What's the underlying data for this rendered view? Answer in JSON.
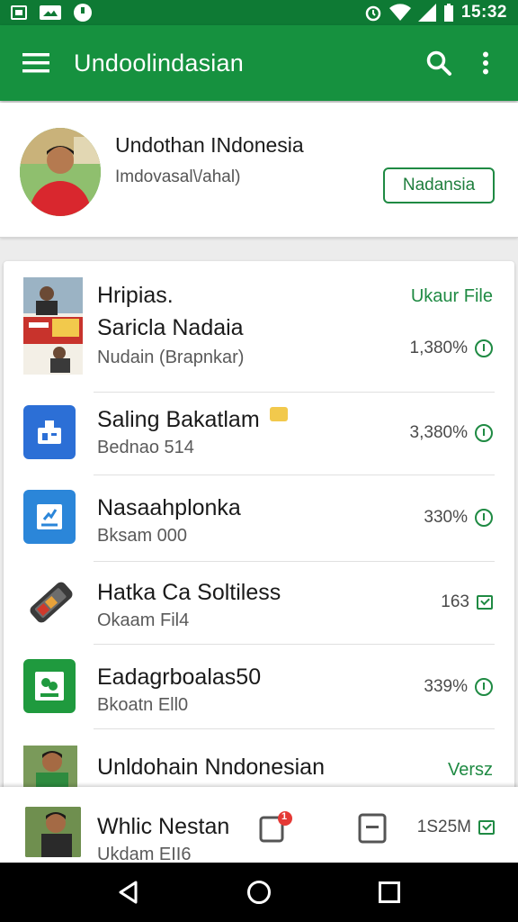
{
  "status_bar": {
    "time": "15:32"
  },
  "app_bar": {
    "title": "Undoolindasian",
    "icons": [
      "menu-icon",
      "search-icon",
      "more-vert-icon"
    ]
  },
  "profile": {
    "name": "Undothan INdonesia",
    "subtitle": "Imdovasal\\/ahal)",
    "button_label": "Nadansia"
  },
  "list": {
    "items": [
      {
        "title": "Hripias.",
        "title2": "Saricla Nadaia",
        "subtitle": "Nudain (Brapnkar)",
        "action": "Ukaur File",
        "meta": "1,380%",
        "meta_icon": "info-icon"
      },
      {
        "title": "Saling Bakatlam",
        "subtitle": "Bednao 514",
        "meta": "3,380%",
        "meta_icon": "info-icon"
      },
      {
        "title": "Nasaahplonka",
        "subtitle": "Bksam 000",
        "meta": "330%",
        "meta_icon": "info-icon"
      },
      {
        "title": "Hatka Ca Soltiless",
        "subtitle": "Okaam Fil4",
        "meta": "163",
        "meta_icon": "check-box-icon"
      },
      {
        "title": "Eadagrboalas50",
        "subtitle": "Bkoatn Ell0",
        "meta": "339%",
        "meta_icon": "info-icon"
      },
      {
        "title": "Unldohain Nndonesian",
        "action": "Versz"
      }
    ]
  },
  "bottom_bar": {
    "title": "Whlic Nestan",
    "subtitle": "Ukdam EII6",
    "badge": "1",
    "size": "1S25M"
  },
  "colors": {
    "primary": "#16913f",
    "status": "#0e7a34",
    "accent": "#1f8a43"
  }
}
